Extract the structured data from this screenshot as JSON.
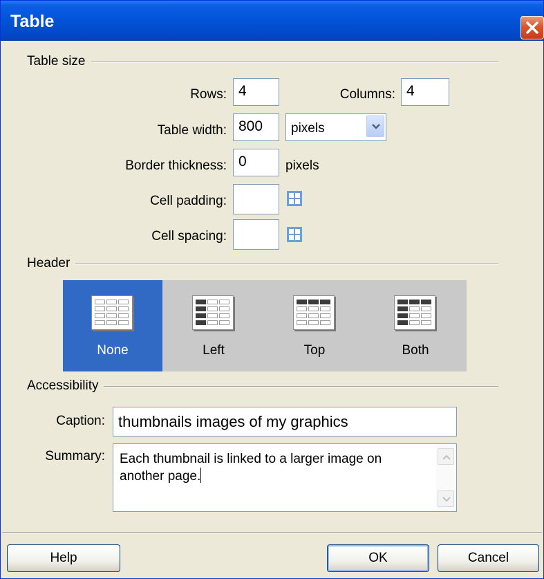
{
  "window": {
    "title": "Table"
  },
  "sections": {
    "table_size": "Table size",
    "header": "Header",
    "accessibility": "Accessibility"
  },
  "table_size": {
    "rows_label": "Rows:",
    "rows_value": "4",
    "columns_label": "Columns:",
    "columns_value": "4",
    "width_label": "Table width:",
    "width_value": "800",
    "width_unit": "pixels",
    "border_label": "Border thickness:",
    "border_value": "0",
    "border_unit": "pixels",
    "padding_label": "Cell padding:",
    "padding_value": "",
    "spacing_label": "Cell spacing:",
    "spacing_value": ""
  },
  "header_options": [
    {
      "label": "None",
      "selected": true
    },
    {
      "label": "Left",
      "selected": false
    },
    {
      "label": "Top",
      "selected": false
    },
    {
      "label": "Both",
      "selected": false
    }
  ],
  "accessibility": {
    "caption_label": "Caption:",
    "caption_value": "thumbnails images of my graphics",
    "summary_label": "Summary:",
    "summary_value": "Each thumbnail is linked to a larger image on another page."
  },
  "buttons": {
    "help": "Help",
    "ok": "OK",
    "cancel": "Cancel"
  },
  "colors": {
    "titlebar": "#0352d6",
    "dialog_bg": "#ece9d8",
    "selected_option": "#316ac5",
    "close_button": "#d9562e"
  },
  "icons": {
    "close": "close-icon",
    "dropdown": "chevron-down-icon",
    "cell_padding": "cell-padding-icon",
    "cell_spacing": "cell-spacing-icon",
    "scroll_up": "scroll-up-arrow-icon",
    "scroll_down": "scroll-down-arrow-icon"
  }
}
